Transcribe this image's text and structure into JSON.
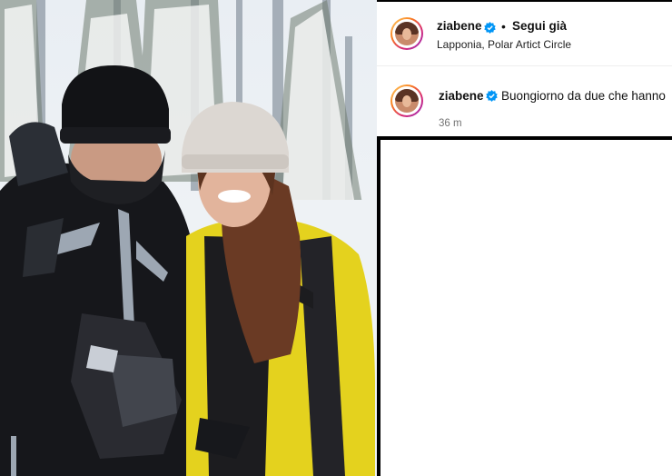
{
  "post": {
    "username": "ziabene",
    "follow_status": "Segui già",
    "location": "Lapponia, Polar Artict Circle"
  },
  "comment": {
    "username": "ziabene",
    "text": "Buongiorno da due che hanno",
    "time": "36 m"
  },
  "icons": {
    "verified": "verified-badge-icon",
    "avatar": "avatar"
  },
  "colors": {
    "verified_blue": "#0095f6",
    "ring": "#d62976"
  }
}
